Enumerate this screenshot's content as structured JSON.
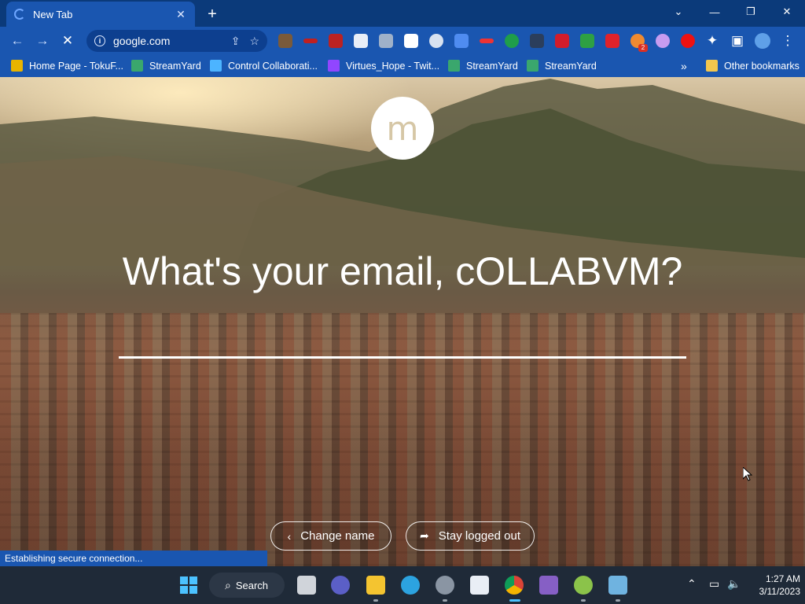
{
  "browser": {
    "tab_title": "New Tab",
    "url": "google.com",
    "new_tab_symbol": "+",
    "window_controls": {
      "minimize": "—",
      "restore": "❐",
      "close": "✕",
      "tab_list": "⌄"
    }
  },
  "bookmarks": [
    {
      "label": "Home Page - TokuF...",
      "icon_color": "#e8b400"
    },
    {
      "label": "StreamYard",
      "icon_color": "#3aa76d"
    },
    {
      "label": "Control Collaborati...",
      "icon_color": "#4cb4ff"
    },
    {
      "label": "Virtues_Hope - Twit...",
      "icon_color": "#9146ff"
    },
    {
      "label": "StreamYard",
      "icon_color": "#3aa76d"
    },
    {
      "label": "StreamYard",
      "icon_color": "#3aa76d"
    }
  ],
  "bookmarks_overflow": "»",
  "other_bookmarks": "Other bookmarks",
  "page": {
    "logo_letter": "m",
    "question": "What's your email, cOLLABVM?",
    "email_value": "",
    "change_name_label": "Change name",
    "stay_logged_out_label": "Stay logged out"
  },
  "status_text": "Establishing secure connection...",
  "taskbar": {
    "search_label": "Search",
    "time": "1:27 AM",
    "date": "3/11/2023"
  },
  "colors": {
    "frame": "#1a56b0",
    "tabstrip": "#0b3a7a",
    "taskbar": "#1f2a38"
  }
}
